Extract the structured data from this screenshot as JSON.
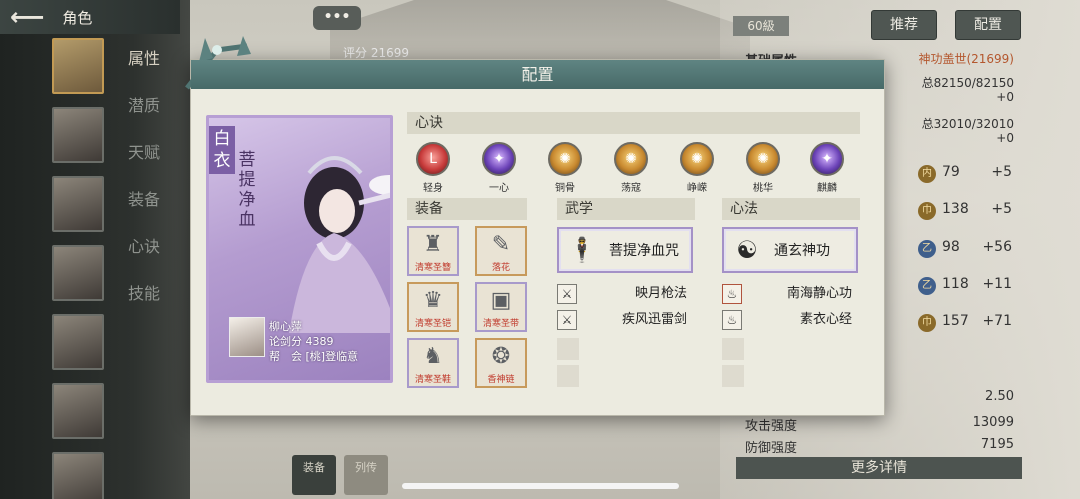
{
  "topbar": {
    "title": "角色"
  },
  "menu": [
    "属性",
    "潜质",
    "天赋",
    "装备",
    "心诀",
    "技能"
  ],
  "background": {
    "chat_label": "•••",
    "score_label": "评分 21699",
    "level": "60級",
    "btn_recommend": "推荐",
    "btn_config": "配置",
    "right_panel": {
      "title": "基础属性",
      "set_name": "神功盖世(21699)",
      "hp": "总82150/82150",
      "hp_plus": "+0",
      "mp": "总32010/32010",
      "mp_plus": "+0",
      "attrs": [
        {
          "icon": "内",
          "value": "79",
          "plus": "+5"
        },
        {
          "icon": "巾",
          "value": "138",
          "plus": "+5"
        },
        {
          "icon": "乙",
          "value": "98",
          "plus": "+56"
        },
        {
          "icon": "乙",
          "value": "118",
          "plus": "+11"
        },
        {
          "icon": "巾",
          "value": "157",
          "plus": "+71"
        }
      ],
      "stat_value_1": "2.50",
      "attack_label": "攻击强度",
      "attack_value": "13099",
      "defense_label": "防御强度",
      "defense_value": "7195",
      "more_label": "更多详情"
    },
    "bottom_tabs": [
      "装备",
      "列传"
    ]
  },
  "modal": {
    "title": "配置",
    "card": {
      "tag": "白衣",
      "vertical_title": "菩提净血",
      "name": "柳心萍",
      "score": "论剑分 4389",
      "guild": "帮　会 [桃]登临意"
    },
    "xinjue": {
      "header": "心诀",
      "items": [
        {
          "label": "轻身",
          "color": "red",
          "glyph": "L"
        },
        {
          "label": "一心",
          "color": "purple",
          "glyph": "✦"
        },
        {
          "label": "铜骨",
          "color": "gold",
          "glyph": "✺"
        },
        {
          "label": "荡寇",
          "color": "gold",
          "glyph": "✺"
        },
        {
          "label": "峥嵘",
          "color": "gold",
          "glyph": "✺"
        },
        {
          "label": "桃华",
          "color": "gold",
          "glyph": "✺"
        },
        {
          "label": "麒麟",
          "color": "purple",
          "glyph": "✦"
        }
      ]
    },
    "equip": {
      "header": "装备",
      "items": [
        {
          "name": "清寒圣簪",
          "glyph": "♜",
          "border": "purple"
        },
        {
          "name": "落花",
          "glyph": "✎",
          "border": "gold"
        },
        {
          "name": "清寒圣铠",
          "glyph": "♛",
          "border": "gold"
        },
        {
          "name": "清寒圣带",
          "glyph": "▣",
          "border": "purple"
        },
        {
          "name": "清寒圣鞋",
          "glyph": "♞",
          "border": "purple"
        },
        {
          "name": "香神链",
          "glyph": "❂",
          "border": "gold"
        }
      ]
    },
    "wuxue": {
      "header": "武学",
      "main": "菩提净血咒",
      "subs": [
        "映月枪法",
        "疾风迅雷剑"
      ]
    },
    "xinfa": {
      "header": "心法",
      "main": "通玄神功",
      "subs": [
        "南海静心功",
        "素衣心经"
      ]
    }
  }
}
